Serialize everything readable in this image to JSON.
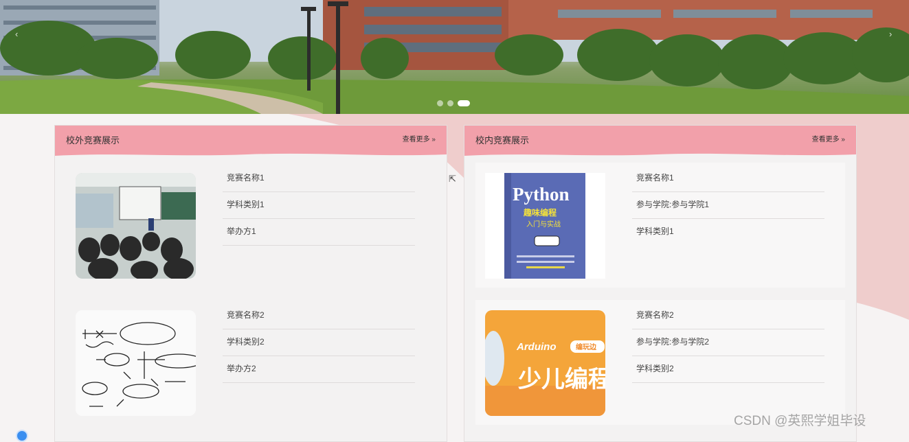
{
  "banner": {
    "slides": 3,
    "active_slide": 3,
    "prev_arrow": "‹",
    "next_arrow": "›"
  },
  "external": {
    "title": "校外竞赛展示",
    "more": "查看更多 »",
    "items": [
      {
        "image": "classroom-photo",
        "name": "竞赛名称1",
        "category": "学科类别1",
        "organizer": "举办方1"
      },
      {
        "image": "handwritten-notes",
        "name": "竞赛名称2",
        "category": "学科类别2",
        "organizer": "举办方2"
      }
    ]
  },
  "internal": {
    "title": "校内竞赛展示",
    "more": "查看更多 »",
    "items": [
      {
        "image": "python-book-cover",
        "name": "竞赛名称1",
        "college": "参与学院:参与学院1",
        "category": "学科类别1"
      },
      {
        "image": "arduino-kids-coding",
        "name": "竞赛名称2",
        "college": "参与学院:参与学院2",
        "category": "学科类别2"
      }
    ]
  },
  "book_cover": {
    "title": "Python",
    "subtitle": "趣味编程",
    "subtitle2": "入门与实战"
  },
  "arduino_cover": {
    "brand": "Arduino",
    "tag": "编玩边",
    "headline": "少儿编程"
  },
  "watermark": "CSDN @英熙学姐毕设",
  "colors": {
    "accent": "#f2a0aa",
    "backdrop": "#f0c9c9",
    "panel": "#f3f2f2"
  }
}
